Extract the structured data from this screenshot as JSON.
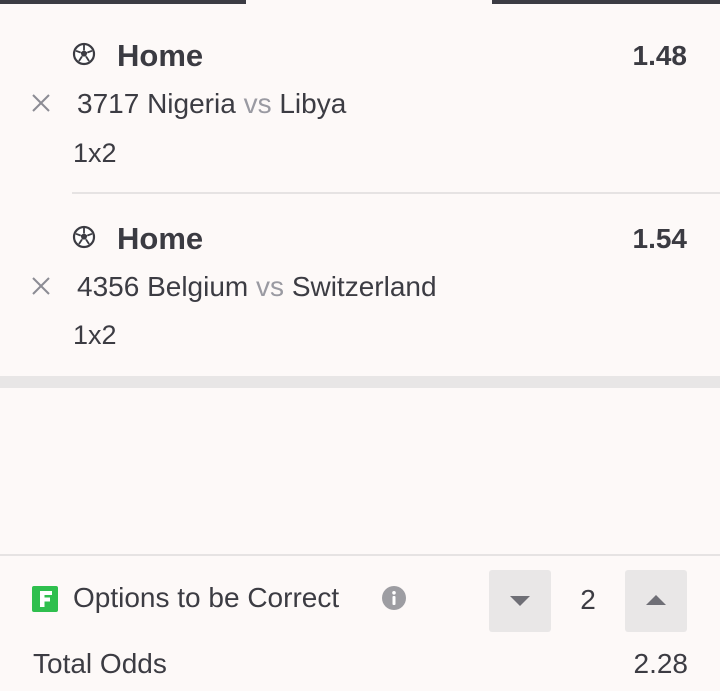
{
  "bets": [
    {
      "pick": "Home",
      "odds": "1.48",
      "event_id": "3717",
      "home_team": "Nigeria",
      "vs": "vs",
      "away_team": "Libya",
      "market": "1x2"
    },
    {
      "pick": "Home",
      "odds": "1.54",
      "event_id": "4356",
      "home_team": "Belgium",
      "vs": "vs",
      "away_team": "Switzerland",
      "market": "1x2"
    }
  ],
  "footer": {
    "options_label": "Options to be Correct",
    "options_value": "2",
    "total_label": "Total Odds",
    "total_value": "2.28"
  },
  "colors": {
    "background": "#fdf9f8",
    "text": "#3c3c43",
    "muted": "#9a9aa2",
    "stepper_bg": "#e9e7e7",
    "logo_green": "#2fbf4e"
  },
  "icons": {
    "sport": "soccer-ball-icon",
    "remove": "close-icon",
    "flexi": "flexi-logo-icon",
    "info": "info-icon",
    "decrease": "chevron-down-icon",
    "increase": "chevron-up-icon"
  }
}
